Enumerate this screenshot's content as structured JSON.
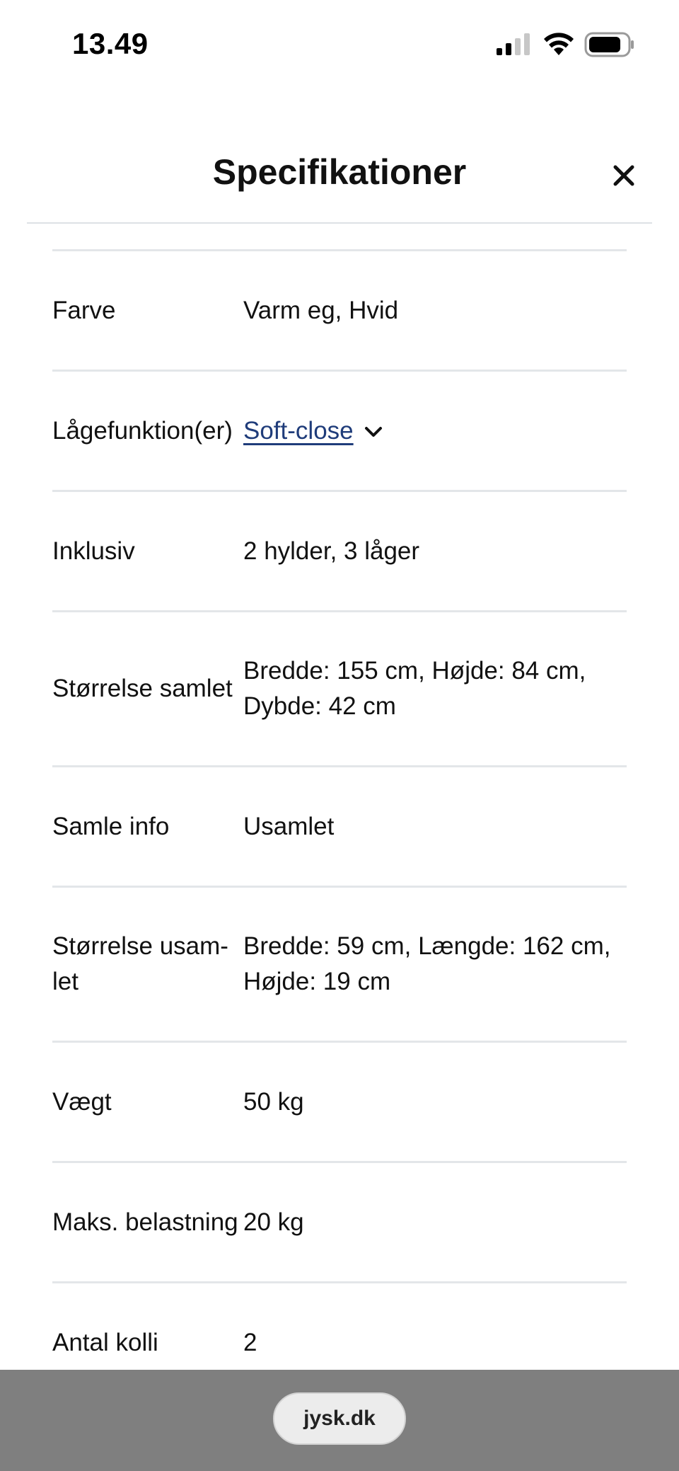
{
  "status_bar": {
    "time": "13.49",
    "icons": [
      "signal-icon",
      "wifi-icon",
      "battery-icon"
    ]
  },
  "header": {
    "title": "Specifikationer",
    "close_icon": "close-icon"
  },
  "specs": [
    {
      "label": "Farve",
      "value": "Varm eg, Hvid"
    },
    {
      "label": "Lågefunktion(er)",
      "value": "Soft-close",
      "is_link": true
    },
    {
      "label": "Inklusiv",
      "value": "2 hylder, 3 låger"
    },
    {
      "label": "Størrelse samlet",
      "value": "Bredde: 155 cm, Højde: 84 cm, Dybde: 42 cm"
    },
    {
      "label": "Samle info",
      "value": "Usamlet"
    },
    {
      "label": "Størrelse usam-let",
      "value": "Bredde: 59 cm, Længde: 162 cm, Højde: 19 cm"
    },
    {
      "label": "Vægt",
      "value": "50 kg"
    },
    {
      "label": "Maks. belastning",
      "value": "20 kg"
    },
    {
      "label": "Antal kolli",
      "value": "2"
    }
  ],
  "browser": {
    "url": "jysk.dk"
  },
  "colors": {
    "link": "#1f3c7a",
    "divider": "#e3e6e9",
    "browser_bar": "#7f7f7f"
  }
}
